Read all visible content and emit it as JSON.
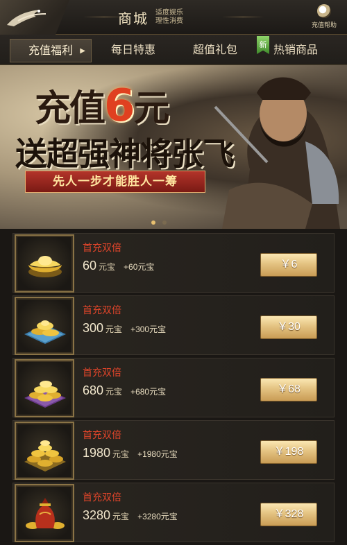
{
  "header": {
    "title": "商城",
    "slogan_line1": "适度娱乐",
    "slogan_line2": "理性消费",
    "help_label": "充值帮助"
  },
  "tabs": [
    {
      "label": "充值福利",
      "active": true
    },
    {
      "label": "每日特惠",
      "active": false
    },
    {
      "label": "超值礼包",
      "active": false
    },
    {
      "label": "热销商品",
      "active": false,
      "badge": "新"
    }
  ],
  "banner": {
    "line1_prefix": "充值",
    "line1_number": "6",
    "line1_suffix": "元",
    "line2": "送超强神将张飞",
    "ribbon": "先人一步才能胜人一筹",
    "active_slide": 1,
    "slide_count": 2
  },
  "items": [
    {
      "label": "首充双倍",
      "amount": "60",
      "unit": "元宝",
      "bonus": "+60元宝",
      "price": "￥6",
      "icon": "ingot-single-icon"
    },
    {
      "label": "首充双倍",
      "amount": "300",
      "unit": "元宝",
      "bonus": "+300元宝",
      "price": "￥30",
      "icon": "ingot-pile-blue-icon"
    },
    {
      "label": "首充双倍",
      "amount": "680",
      "unit": "元宝",
      "bonus": "+680元宝",
      "price": "￥68",
      "icon": "ingot-pile-purple-icon"
    },
    {
      "label": "首充双倍",
      "amount": "1980",
      "unit": "元宝",
      "bonus": "+1980元宝",
      "price": "￥198",
      "icon": "ingot-pile-gold-icon"
    },
    {
      "label": "首充双倍",
      "amount": "3280",
      "unit": "元宝",
      "bonus": "+3280元宝",
      "price": "￥328",
      "icon": "ingot-bag-icon"
    }
  ],
  "colors": {
    "accent_red": "#e0452a",
    "gold_button": "#e4c382",
    "background": "#1a1714"
  }
}
